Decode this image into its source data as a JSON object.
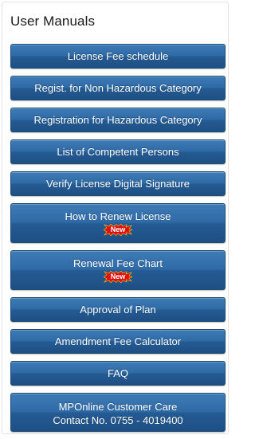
{
  "panel": {
    "title": "User Manuals"
  },
  "menu": {
    "items": [
      {
        "label": "License Fee schedule"
      },
      {
        "label": "Regist. for Non Hazardous Category"
      },
      {
        "label": "Registration for Hazardous Category"
      },
      {
        "label": "List of Competent Persons"
      },
      {
        "label": "Verify License Digital Signature"
      },
      {
        "label": "How to Renew License",
        "badge": "New"
      },
      {
        "label": "Renewal Fee Chart",
        "badge": "New"
      },
      {
        "label": "Approval of Plan"
      },
      {
        "label": "Amendment Fee Calculator"
      },
      {
        "label": "FAQ"
      },
      {
        "line1": "MPOnline Customer Care",
        "line2": "Contact No. 0755 - 4019400"
      }
    ]
  },
  "colors": {
    "button": "#2f6aa6",
    "button_border": "#1f4d79",
    "badge": "#e01010"
  },
  "icons": {
    "badge": "new-starburst-icon"
  }
}
